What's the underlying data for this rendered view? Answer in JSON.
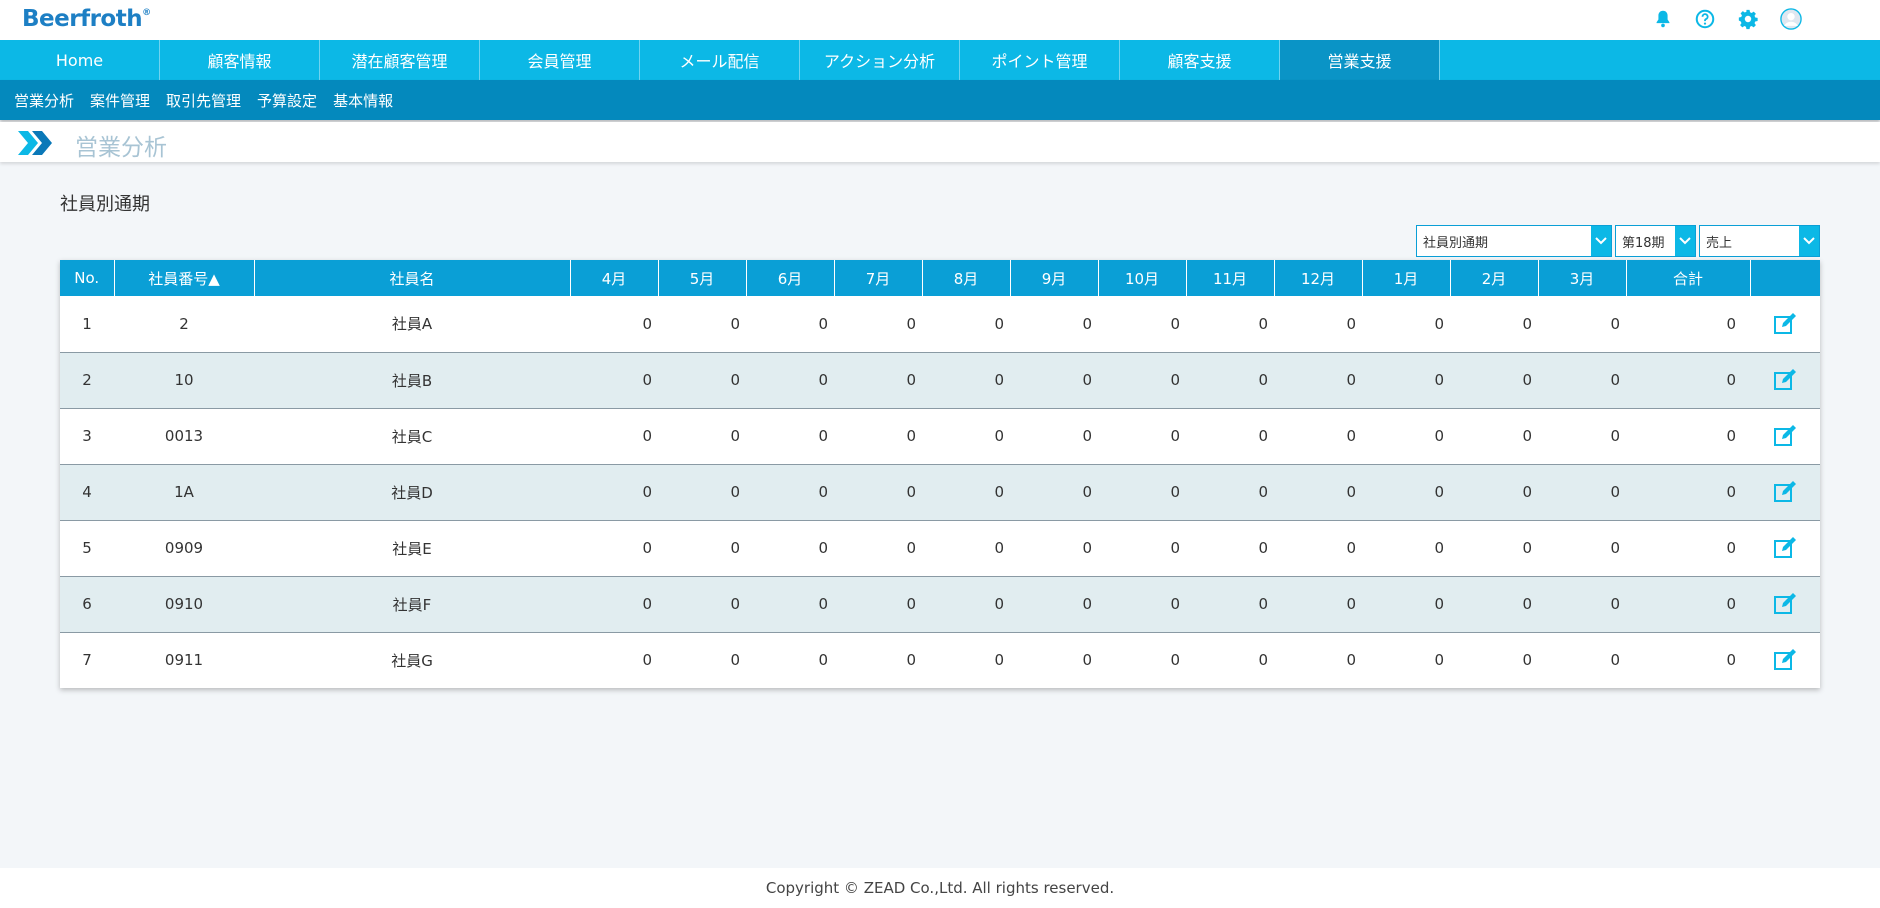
{
  "app": {
    "logo": "Beerfroth",
    "logo_mark": "®"
  },
  "top_icons": [
    "bell-icon",
    "help-icon",
    "gear-icon",
    "avatar-icon"
  ],
  "main_nav": {
    "tabs": [
      "Home",
      "顧客情報",
      "潜在顧客管理",
      "会員管理",
      "メール配信",
      "アクション分析",
      "ポイント管理",
      "顧客支援",
      "営業支援"
    ],
    "active": "営業支援"
  },
  "sub_nav": {
    "items": [
      "営業分析",
      "案件管理",
      "取引先管理",
      "予算設定",
      "基本情報"
    ]
  },
  "page": {
    "title": "営業分析",
    "section_title": "社員別通期"
  },
  "filters": {
    "view": "社員別通期",
    "period": "第18期",
    "metric": "売上"
  },
  "table": {
    "headers": [
      "No.",
      "社員番号▲",
      "社員名",
      "4月",
      "5月",
      "6月",
      "7月",
      "8月",
      "9月",
      "10月",
      "11月",
      "12月",
      "1月",
      "2月",
      "3月",
      "合計",
      ""
    ],
    "rows": [
      {
        "no": "1",
        "emp_no": "2",
        "name": "社員A",
        "months": [
          "0",
          "0",
          "0",
          "0",
          "0",
          "0",
          "0",
          "0",
          "0",
          "0",
          "0",
          "0"
        ],
        "total": "0"
      },
      {
        "no": "2",
        "emp_no": "10",
        "name": "社員B",
        "months": [
          "0",
          "0",
          "0",
          "0",
          "0",
          "0",
          "0",
          "0",
          "0",
          "0",
          "0",
          "0"
        ],
        "total": "0"
      },
      {
        "no": "3",
        "emp_no": "0013",
        "name": "社員C",
        "months": [
          "0",
          "0",
          "0",
          "0",
          "0",
          "0",
          "0",
          "0",
          "0",
          "0",
          "0",
          "0"
        ],
        "total": "0"
      },
      {
        "no": "4",
        "emp_no": "1A",
        "name": "社員D",
        "months": [
          "0",
          "0",
          "0",
          "0",
          "0",
          "0",
          "0",
          "0",
          "0",
          "0",
          "0",
          "0"
        ],
        "total": "0"
      },
      {
        "no": "5",
        "emp_no": "0909",
        "name": "社員E",
        "months": [
          "0",
          "0",
          "0",
          "0",
          "0",
          "0",
          "0",
          "0",
          "0",
          "0",
          "0",
          "0"
        ],
        "total": "0"
      },
      {
        "no": "6",
        "emp_no": "0910",
        "name": "社員F",
        "months": [
          "0",
          "0",
          "0",
          "0",
          "0",
          "0",
          "0",
          "0",
          "0",
          "0",
          "0",
          "0"
        ],
        "total": "0"
      },
      {
        "no": "7",
        "emp_no": "0911",
        "name": "社員G",
        "months": [
          "0",
          "0",
          "0",
          "0",
          "0",
          "0",
          "0",
          "0",
          "0",
          "0",
          "0",
          "0"
        ],
        "total": "0"
      }
    ]
  },
  "footer": {
    "copyright": "Copyright © ZEAD Co.,Ltd. All rights reserved."
  },
  "colors": {
    "nav": "#0cb8e6",
    "nav_active": "#0a94c6",
    "subnav": "#0489bd",
    "table_header": "#0a9fd6",
    "row_alt": "#e1edf0"
  }
}
